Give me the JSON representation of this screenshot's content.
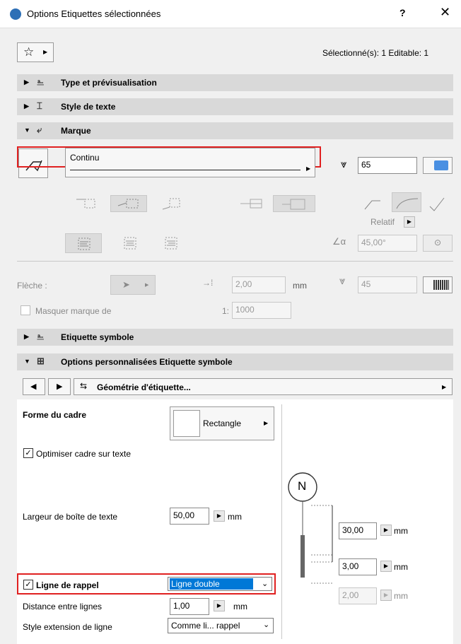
{
  "window": {
    "title": "Options Etiquettes sélectionnées",
    "help": "?",
    "close": "✕"
  },
  "header": {
    "selection_status": "Sélectionné(s): 1 Editable: 1"
  },
  "sections": {
    "type": "Type et prévisualisation",
    "style": "Style de texte",
    "marque": "Marque",
    "etiquette": "Etiquette symbole",
    "options": "Options personnalisées Etiquette symbole"
  },
  "marque": {
    "line_type": "Continu",
    "pen_value": "65",
    "relatif_label": "Relatif",
    "angle_value": "45,00°"
  },
  "fleche": {
    "label": "Flèche :",
    "size_value": "2,00",
    "size_unit": "mm",
    "pen_value": "45",
    "hide_label": "Masquer marque de",
    "scale_prefix": "1:",
    "scale_value": "1000"
  },
  "nav": {
    "geometry_label": "Géométrie d'étiquette..."
  },
  "geometry": {
    "frame_shape_label": "Forme du cadre",
    "frame_shape_value": "Rectangle",
    "optimize_label": "Optimiser cadre sur texte",
    "text_box_width_label": "Largeur de boîte de texte",
    "text_box_width_value": "50,00",
    "text_box_width_unit": "mm",
    "leader_label": "Ligne de rappel",
    "leader_value": "Ligne double",
    "line_distance_label": "Distance entre lignes",
    "line_distance_value": "1,00",
    "line_distance_unit": "mm",
    "extension_style_label": "Style extension de ligne",
    "extension_style_value": "Comme li... rappel"
  },
  "preview": {
    "marker_letter": "N",
    "dim1_value": "30,00",
    "dim1_unit": "mm",
    "dim2_value": "3,00",
    "dim2_unit": "mm",
    "dim3_value": "2,00",
    "dim3_unit": "mm"
  }
}
